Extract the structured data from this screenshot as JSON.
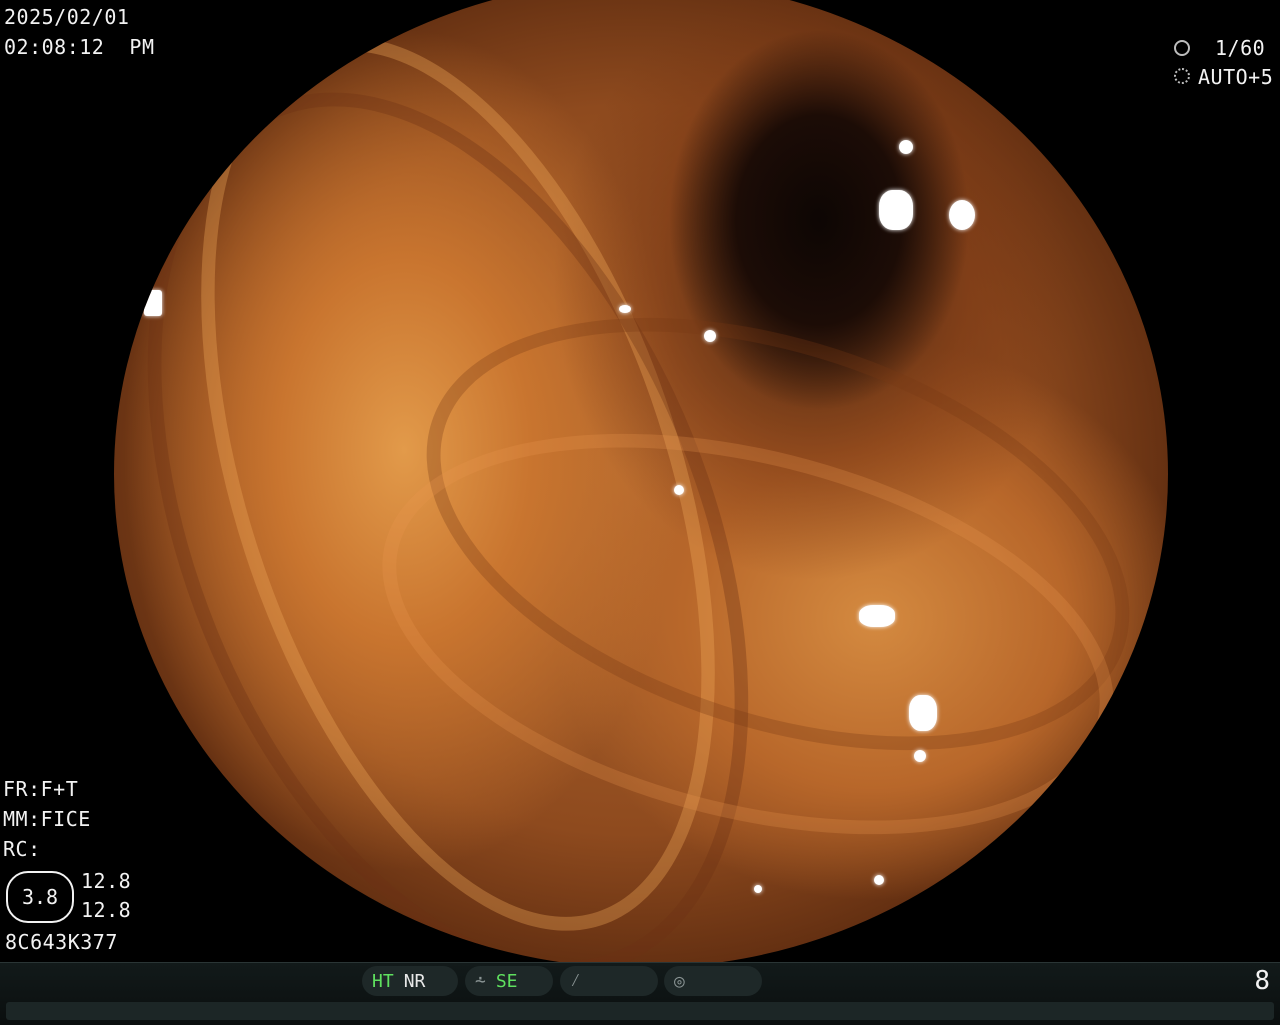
{
  "overlay": {
    "date": "2025/02/01",
    "time": "02:08:12  PM",
    "shutter": "1/60",
    "exposure": "AUTO+5",
    "fr": "FR:F+T",
    "mm": "MM:FICE",
    "rc": "RC:",
    "ring_value": "3.8",
    "val_top": "12.8",
    "val_bottom": "12.8",
    "serial": "8C643K377"
  },
  "status_bar": {
    "ht": "HT",
    "nr": "NR",
    "se": "SE",
    "page": "8"
  },
  "icons": [
    "shutter-icon",
    "aperture-icon",
    "structure-enhance-icon",
    "freeze-icon",
    "signal-icon"
  ],
  "colors": {
    "status_green": "#5fe05f",
    "text": "#f2f2f2"
  }
}
